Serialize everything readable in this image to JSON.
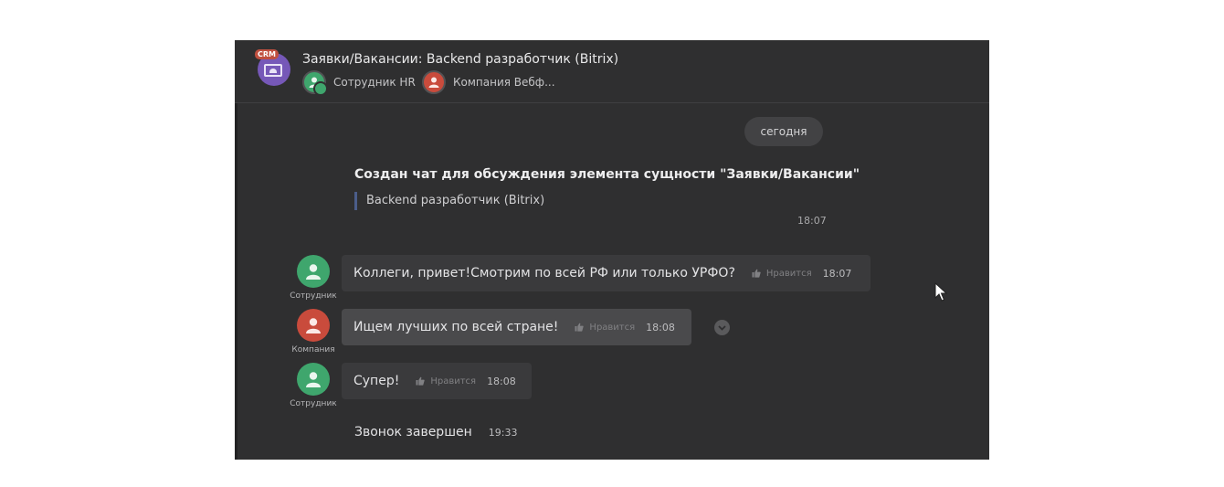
{
  "header": {
    "crm_badge": "CRM",
    "title": "Заявки/Вакансии: Backend разработчик (Bitrix)",
    "members": [
      {
        "name": "Сотрудник HR",
        "avatar_color": "#3fa66d"
      },
      {
        "name": "Компания Вебф...",
        "avatar_color": "#c94b3c"
      }
    ]
  },
  "feed": {
    "date_divider": "сегодня",
    "system_message": {
      "title": "Создан чат для обсуждения элемента сущности \"Заявки/Вакансии\"",
      "quote": "Backend разработчик (Bitrix)",
      "time": "18:07"
    },
    "messages": [
      {
        "author": "Сотрудник",
        "avatar_color": "#3fa66d",
        "text": "Коллеги, привет!Смотрим по всей РФ или только УРФО?",
        "like_label": "Нравится",
        "time": "18:07"
      },
      {
        "author": "Компания",
        "avatar_color": "#c94b3c",
        "text": "Ищем лучших по всей стране!",
        "like_label": "Нравится",
        "time": "18:08"
      },
      {
        "author": "Сотрудник",
        "avatar_color": "#3fa66d",
        "text": "Супер!",
        "like_label": "Нравится",
        "time": "18:08"
      }
    ],
    "call": {
      "text": "Звонок завершен",
      "time": "19:33"
    }
  },
  "colors": {
    "window_bg": "#2f2f30",
    "bubble_bg": "#3a3a3c",
    "bubble_hover_bg": "#4a4a4c",
    "green": "#3fa66d",
    "red": "#c94b3c",
    "crm_purple": "#7658b8"
  },
  "icons": [
    "crm-icon",
    "person-icon",
    "thumbs-up-icon",
    "chevron-down-icon",
    "mouse-cursor-icon"
  ]
}
